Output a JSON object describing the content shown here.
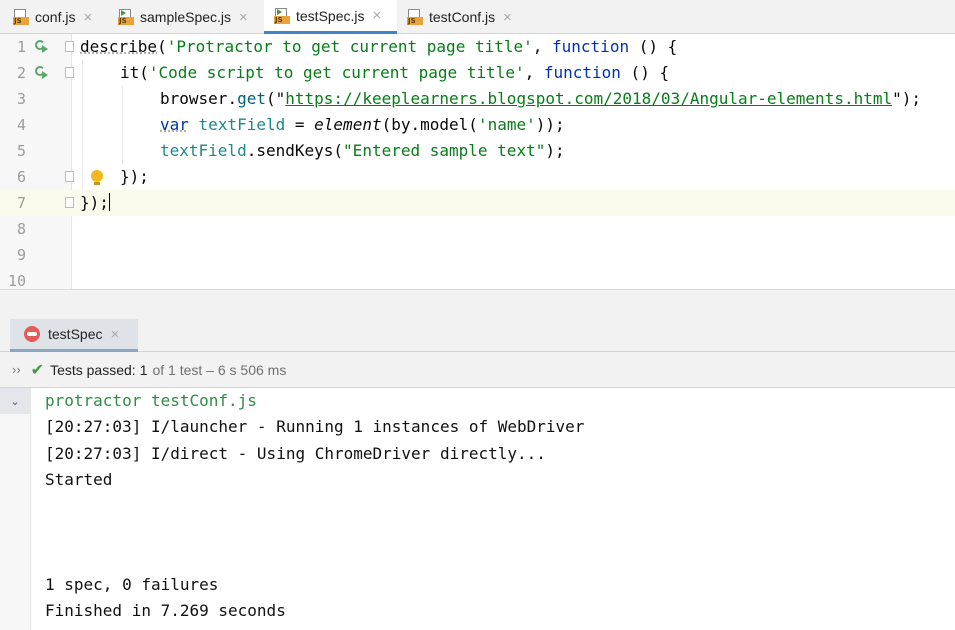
{
  "editor_tabs": [
    {
      "label": "conf.js",
      "active": false
    },
    {
      "label": "sampleSpec.js",
      "active": false
    },
    {
      "label": "testSpec.js",
      "active": true
    },
    {
      "label": "testConf.js",
      "active": false
    }
  ],
  "icons": {
    "js_badge": "JS",
    "close": "×",
    "expand": "››",
    "check": "✔",
    "collapse": "⌄"
  },
  "code": {
    "line_numbers": [
      "1",
      "2",
      "3",
      "4",
      "5",
      "6",
      "7",
      "8",
      "9",
      "10"
    ],
    "l1": {
      "kw": "describe",
      "p1": "(",
      "str": "'Protractor to get current page title'",
      "p2": ", ",
      "fn": "function",
      "p3": " () {"
    },
    "l2": {
      "kw": "it",
      "p1": "(",
      "str": "'Code script to get current page title'",
      "p2": ", ",
      "fn": "function",
      "p3": " () {"
    },
    "l3": {
      "obj": "browser",
      "dot": ".",
      "meth": "get",
      "p1": "(\"",
      "url": "https://keeplearners.blogspot.com/2018/03/Angular-elements.html",
      "p2": "\");"
    },
    "l4": {
      "kw": "var",
      "sp": " ",
      "var": "textField",
      "eq": " = ",
      "fn": "element",
      "p1": "(by.",
      "meth": "model",
      "p2": "(",
      "str": "'name'",
      "p3": "));"
    },
    "l5": {
      "var": "textField",
      "dot": ".",
      "meth": "sendKeys",
      "p1": "(",
      "str": "\"Entered sample text\"",
      "p2": ");"
    },
    "l6": "});",
    "l7": "});"
  },
  "colors": {
    "string": "#067d17",
    "keyword": "#0033b3",
    "variable": "#1a8a8a",
    "run_green": "#59a869",
    "tab_accent": "#4083c9"
  },
  "run": {
    "tab_label": "testSpec",
    "status_label": "Tests passed:",
    "status_count": "1",
    "status_detail": "of 1 test – 6 s 506 ms"
  },
  "console": {
    "lines": [
      "protractor testConf.js",
      "[20:27:03] I/launcher - Running 1 instances of WebDriver",
      "[20:27:03] I/direct - Using ChromeDriver directly...",
      "Started",
      "",
      "",
      "",
      "1 spec, 0 failures",
      "Finished in 7.269 seconds"
    ]
  }
}
